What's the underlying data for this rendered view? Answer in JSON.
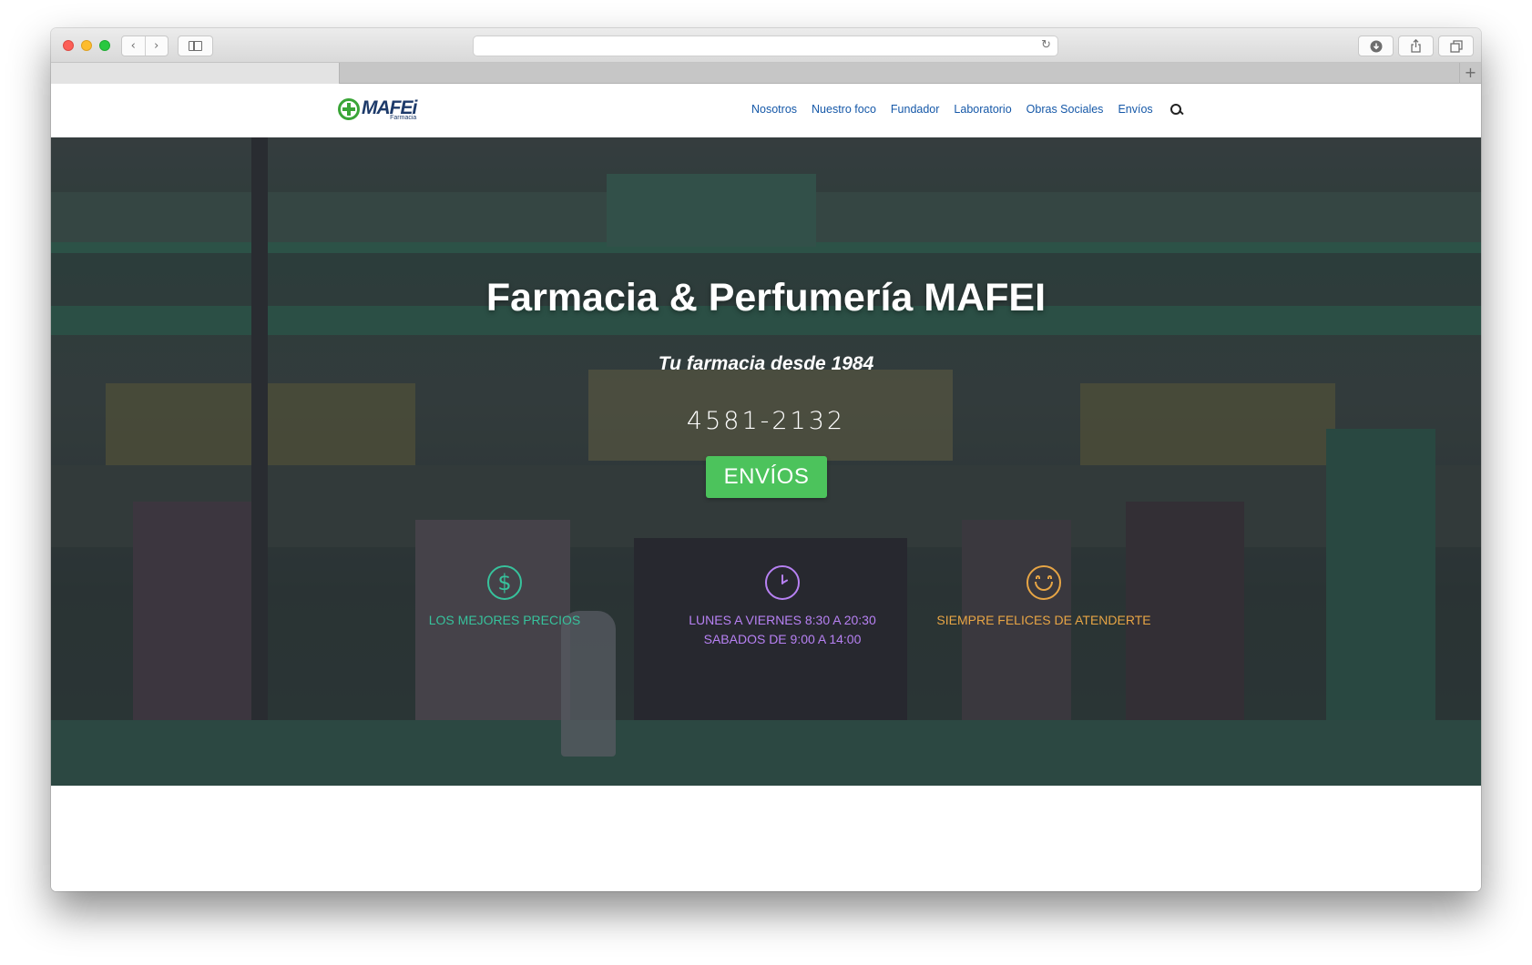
{
  "browser": {
    "nav_back": "‹",
    "nav_forward": "›",
    "reload_icon": "↻",
    "new_tab": "+"
  },
  "site": {
    "logo": {
      "word": "MAFEi",
      "sub": "Farmacia"
    },
    "menu": [
      {
        "label": "Nosotros"
      },
      {
        "label": "Nuestro foco"
      },
      {
        "label": "Fundador"
      },
      {
        "label": "Laboratorio"
      },
      {
        "label": "Obras Sociales"
      },
      {
        "label": "Envíos"
      }
    ]
  },
  "hero": {
    "title": "Farmacia & Perfumería MAFEI",
    "subtitle": "Tu farmacia desde 1984",
    "phone": "4581-2132",
    "cta": "ENVÍOS",
    "features": [
      {
        "icon": "dollar-icon",
        "color": "#37c29c",
        "lines": [
          "LOS MEJORES PRECIOS"
        ]
      },
      {
        "icon": "clock-icon",
        "color": "#b781f3",
        "lines": [
          "LUNES A VIERNES 8:30 A 20:30",
          "SABADOS DE 9:00 A 14:00"
        ]
      },
      {
        "icon": "smile-icon",
        "color": "#e7a545",
        "lines": [
          "SIEMPRE FELICES DE ATENDERTE"
        ]
      }
    ]
  }
}
